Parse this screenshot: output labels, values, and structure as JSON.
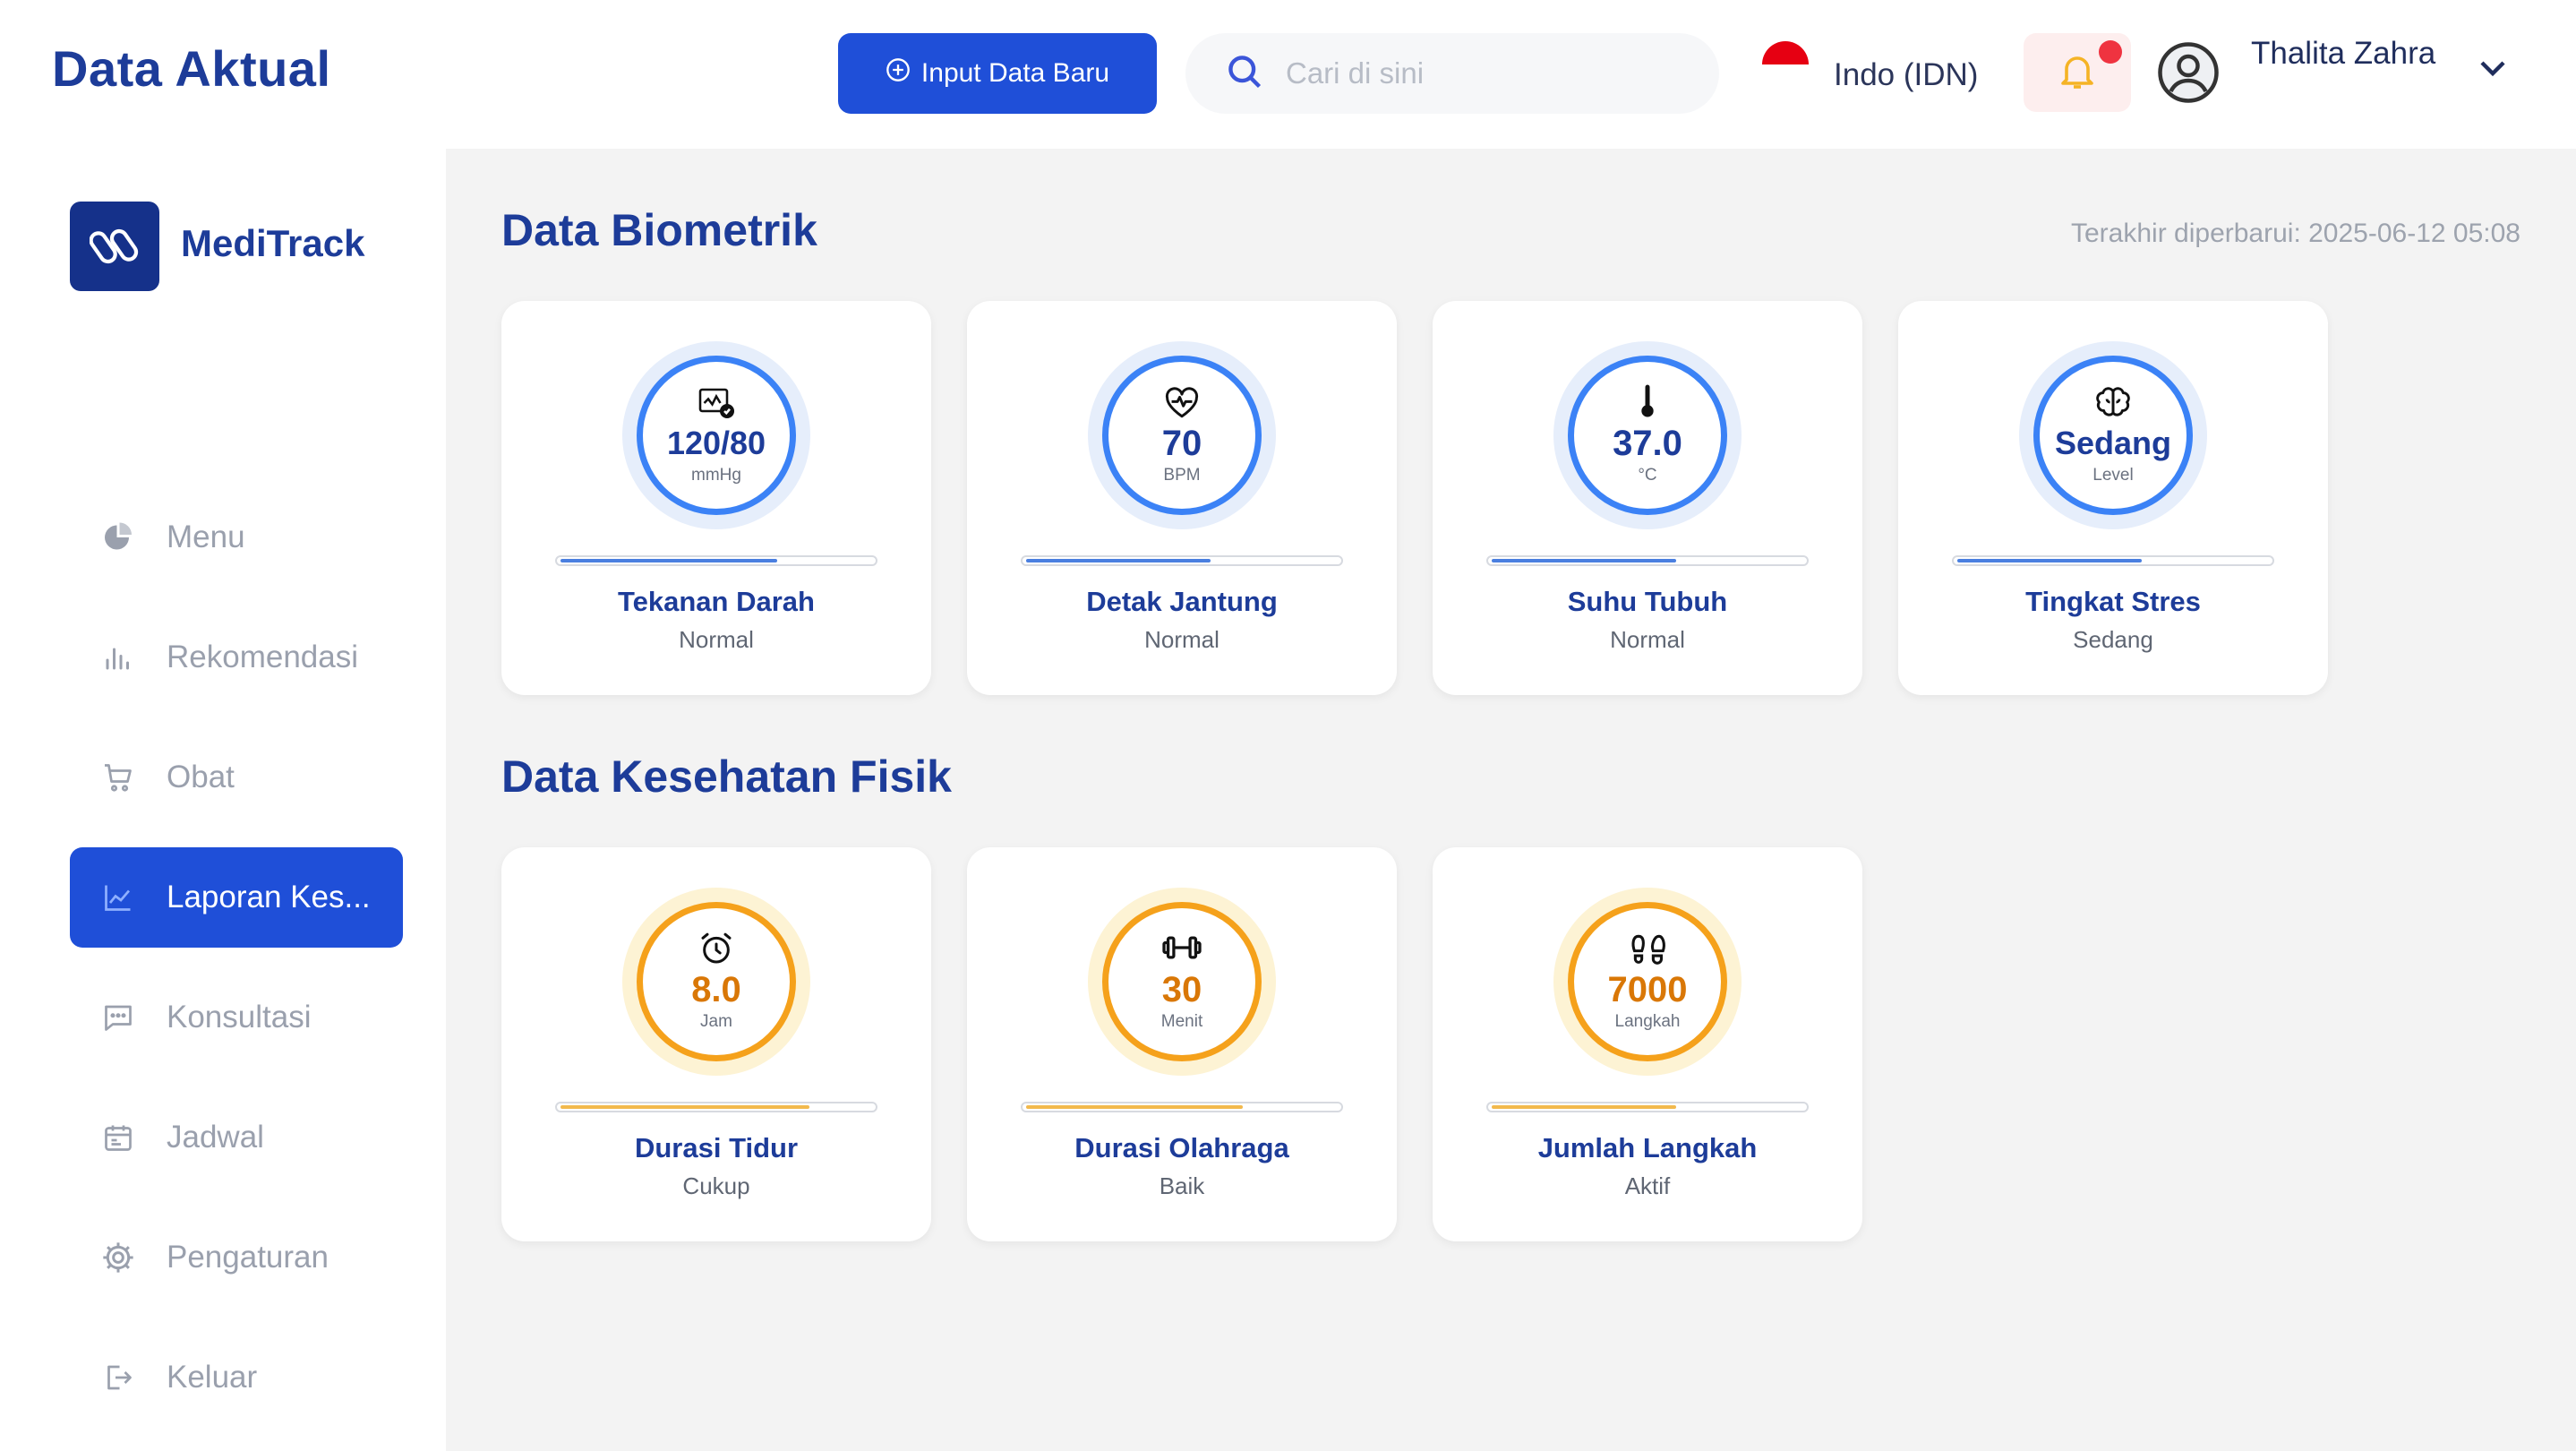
{
  "header": {
    "title": "Data Aktual",
    "input_button_label": "Input Data Baru",
    "search_placeholder": "Cari di sini",
    "language_label": "Indo (IDN)",
    "user_name": "Thalita Zahra"
  },
  "sidebar": {
    "brand": "MediTrack",
    "items": [
      {
        "label": "Menu",
        "icon": "pie-chart-icon"
      },
      {
        "label": "Rekomendasi",
        "icon": "bar-chart-icon"
      },
      {
        "label": "Obat",
        "icon": "cart-icon"
      },
      {
        "label": "Laporan Kes...",
        "icon": "line-chart-icon",
        "active": true
      },
      {
        "label": "Konsultasi",
        "icon": "chat-icon"
      },
      {
        "label": "Jadwal",
        "icon": "calendar-icon"
      },
      {
        "label": "Pengaturan",
        "icon": "gear-icon"
      }
    ],
    "logout_label": "Keluar"
  },
  "biometrik": {
    "title": "Data Biometrik",
    "last_updated": "Terakhir diperbarui: 2025-06-12 05:08",
    "cards": [
      {
        "value": "120/80",
        "unit": "mmHg",
        "title": "Tekanan Darah",
        "status": "Normal",
        "icon": "monitor-heart-icon",
        "progress": 0.68
      },
      {
        "value": "70",
        "unit": "BPM",
        "title": "Detak Jantung",
        "status": "Normal",
        "icon": "heartbeat-icon",
        "progress": 0.58
      },
      {
        "value": "37.0",
        "unit": "°C",
        "title": "Suhu Tubuh",
        "status": "Normal",
        "icon": "thermometer-icon",
        "progress": 0.58
      },
      {
        "value": "Sedang",
        "unit": "Level",
        "title": "Tingkat Stres",
        "status": "Sedang",
        "icon": "brain-icon",
        "progress": 0.58
      }
    ]
  },
  "fisik": {
    "title": "Data Kesehatan Fisik",
    "cards": [
      {
        "value": "8.0",
        "unit": "Jam",
        "title": "Durasi Tidur",
        "status": "Cukup",
        "icon": "alarm-clock-icon",
        "progress": 0.78
      },
      {
        "value": "30",
        "unit": "Menit",
        "title": "Durasi Olahraga",
        "status": "Baik",
        "icon": "dumbbell-icon",
        "progress": 0.68
      },
      {
        "value": "7000",
        "unit": "Langkah",
        "title": "Jumlah Langkah",
        "status": "Aktif",
        "icon": "footprints-icon",
        "progress": 0.58
      }
    ]
  },
  "colors": {
    "primary": "#1f4fd8",
    "title_navy": "#1d3c99",
    "blue_ring": "#3b82f6",
    "orange_ring": "#f5a11b",
    "alert_red": "#ef3340"
  }
}
